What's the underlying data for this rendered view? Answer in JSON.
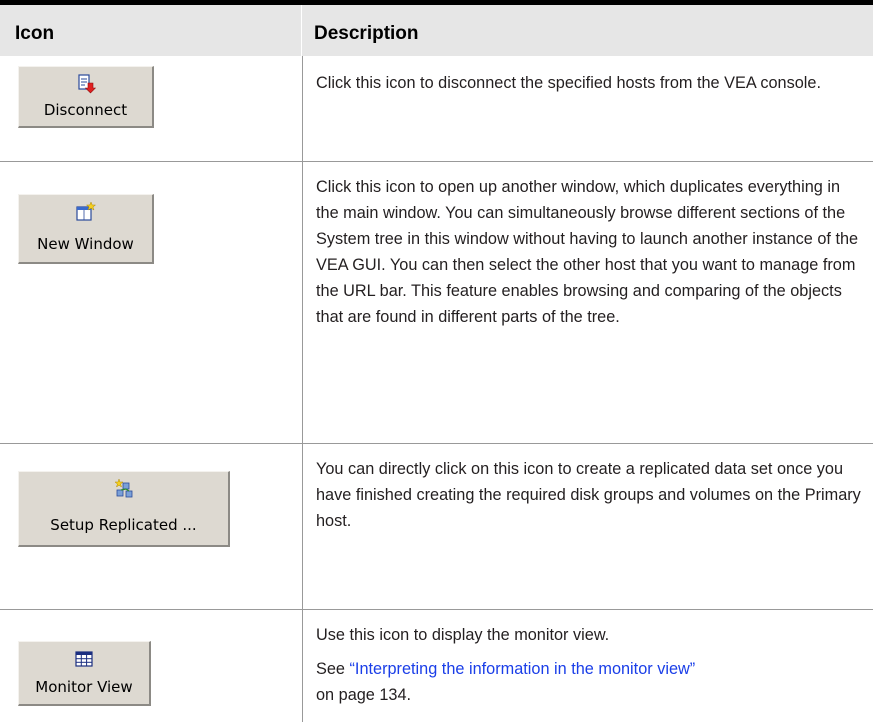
{
  "header": {
    "col_icon": "Icon",
    "col_description": "Description"
  },
  "rows": [
    {
      "button_label": "Disconnect",
      "icon": "disconnect-icon",
      "description": "Click this icon to disconnect the specified hosts from the VEA console."
    },
    {
      "button_label": "New Window",
      "icon": "new-window-icon",
      "description": "Click this icon to open up another window, which duplicates everything in the main window. You can simultaneously browse different sections of the System tree in this window without having to launch another instance of the VEA GUI. You can then select the other host that you want to manage from the URL bar. This feature enables browsing and comparing of the objects that are found in different parts of the tree."
    },
    {
      "button_label": "Setup Replicated ...",
      "icon": "setup-replicated-icon",
      "description": "You can directly click on this icon to create a replicated data set once you have finished creating the required disk groups and volumes on the Primary host."
    },
    {
      "button_label": "Monitor View",
      "icon": "monitor-view-icon",
      "description": "Use this icon to display the monitor view.",
      "see_prefix": "See ",
      "link_text": "“Interpreting the information in the monitor view”",
      "page_ref": "on page 134."
    }
  ],
  "colors": {
    "header_bg": "#e6e6e6",
    "link": "#1a3ee8",
    "button_bg": "#ddd9d1"
  }
}
